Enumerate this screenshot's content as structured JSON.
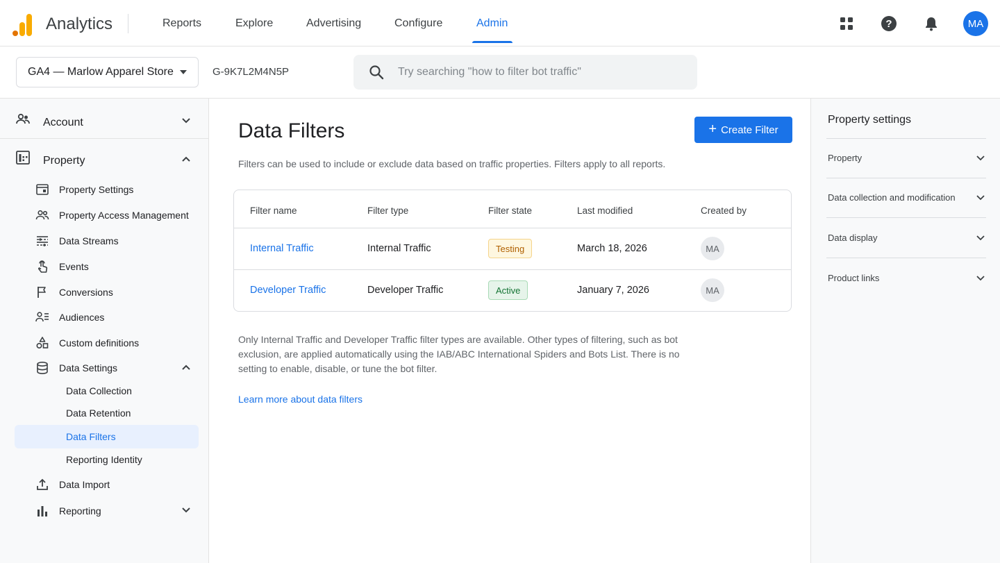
{
  "header": {
    "app_title": "Analytics",
    "nav": [
      "Reports",
      "Explore",
      "Advertising",
      "Configure",
      "Admin"
    ],
    "active_nav": "Admin",
    "avatar_initials": "MA",
    "icons": [
      "apps-grid-icon",
      "help-icon",
      "notifications-bell-icon"
    ],
    "accent_color": "#1a73e8"
  },
  "subbar": {
    "property_select": "GA4 — Marlow Apparel Store",
    "property_id": "G-9K7L2M4N5P",
    "search_placeholder": "Try searching \"how to filter bot traffic\""
  },
  "sidebar": {
    "account_label": "Account",
    "property_label": "Property",
    "items": [
      {
        "label": "Property Settings",
        "icon": "property-settings-icon"
      },
      {
        "label": "Property Access Management",
        "icon": "people-icon"
      },
      {
        "label": "Data Streams",
        "icon": "data-streams-icon"
      },
      {
        "label": "Events",
        "icon": "touch-icon"
      },
      {
        "label": "Conversions",
        "icon": "flag-icon"
      },
      {
        "label": "Audiences",
        "icon": "audiences-icon"
      },
      {
        "label": "Custom definitions",
        "icon": "shapes-icon"
      },
      {
        "label": "Data Settings",
        "icon": "database-icon"
      }
    ],
    "data_settings_sub": [
      "Data Collection",
      "Data Retention",
      "Data Filters",
      "Reporting Identity"
    ],
    "active_sub": "Data Filters",
    "data_import": "Data Import",
    "reporting": "Reporting"
  },
  "main": {
    "title": "Data Filters",
    "create_button": "Create Filter",
    "description": "Filters can be used to include or exclude data based on traffic properties. Filters apply to all reports.",
    "table": {
      "headers": [
        "Filter name",
        "Filter type",
        "Filter state",
        "Last modified",
        "Created by"
      ],
      "rows": [
        {
          "name": "Internal Traffic",
          "type": "Internal Traffic",
          "state": "Testing",
          "modified": "March 18, 2026",
          "creator": "MA"
        },
        {
          "name": "Developer Traffic",
          "type": "Developer Traffic",
          "state": "Active",
          "modified": "January 7, 2026",
          "creator": "MA"
        }
      ]
    },
    "note": "Only Internal Traffic and Developer Traffic filter types are available. Other types of filtering, such as bot exclusion, are applied automatically using the IAB/ABC International Spiders and Bots List. There is no setting to enable, disable, or tune the bot filter.",
    "learn_more": "Learn more about data filters"
  },
  "right_panel": {
    "title": "Property settings",
    "items": [
      "Property",
      "Data collection and modification",
      "Data display",
      "Product links"
    ]
  }
}
